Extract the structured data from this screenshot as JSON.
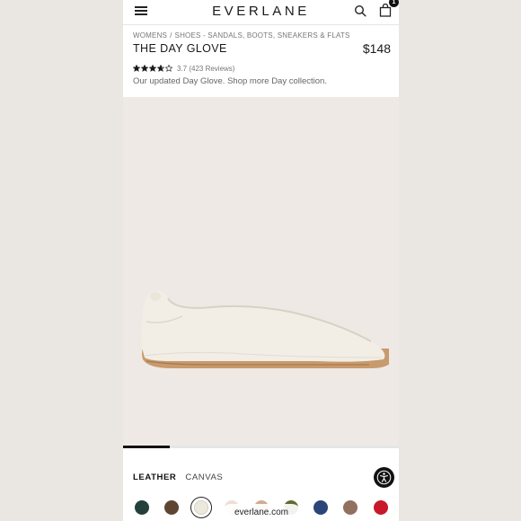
{
  "header": {
    "logo": "EVERLANE",
    "menu_icon": "hamburger-menu-icon",
    "search_icon": "search-icon",
    "bag_icon": "shopping-bag-icon",
    "bag_count": "1"
  },
  "product": {
    "breadcrumb": [
      "WOMENS",
      "SHOES - SANDALS, BOOTS, SNEAKERS & FLATS"
    ],
    "breadcrumb_separator": "/",
    "title": "THE DAY GLOVE",
    "price": "$148",
    "rating_value": 3.7,
    "rating_max": 5,
    "rating_text": "3.7 (423 Reviews)",
    "subtitle": "Our updated Day Glove. Shop more Day collection.",
    "image_progress": 0.17
  },
  "materials": {
    "tabs": [
      "LEATHER",
      "CANVAS"
    ],
    "selected": "LEATHER"
  },
  "swatches": [
    {
      "color": "#24403a"
    },
    {
      "color": "#5e4530"
    },
    {
      "color": "#ece8dc",
      "selected": true
    },
    {
      "color": "#f1ddd6"
    },
    {
      "color": "#d1ab91"
    },
    {
      "color": "#606a2c"
    },
    {
      "color": "#2c4578"
    },
    {
      "color": "#92705f"
    },
    {
      "color": "#c8182a"
    }
  ],
  "accessibility_icon": "accessibility-icon",
  "footer": {
    "domain": "everlane.com"
  },
  "colors": {
    "background": "#ece8e4",
    "product_bg": "#efe9e5",
    "shoe": "#f2eee6",
    "sole": "#c89a6d"
  }
}
